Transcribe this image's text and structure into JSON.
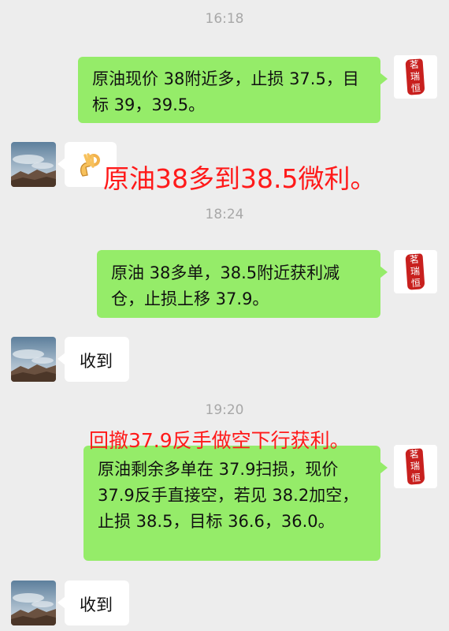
{
  "chat": {
    "times": [
      "16:18",
      "18:24",
      "19:20"
    ],
    "messages": [
      {
        "sender": "self",
        "text": "原油现价 38附近多，止损 37.5，目标 39，39.5。"
      },
      {
        "sender": "other",
        "emoji": "ok-hand-emoji"
      },
      {
        "sender": "self",
        "text": "原油 38多单，38.5附近获利减仓，止损上移 37.9。"
      },
      {
        "sender": "other",
        "text": "收到"
      },
      {
        "sender": "self",
        "text": "原油剩余多单在 37.9扫损，现价 37.9反手直接空，若见 38.2加空，止损 38.5，目标 36.6，36.0。"
      },
      {
        "sender": "other",
        "text": "收到"
      }
    ]
  },
  "annotations": {
    "first": "原油38多到38.5微利。",
    "second": "回撤37.9反手做空下行获利。"
  },
  "self_avatar": {
    "seal_chars": [
      "茗",
      "瑞",
      "恒"
    ],
    "seal_color": "#c8201e"
  },
  "colors": {
    "background": "#ededed",
    "self_bubble": "#95ec69",
    "other_bubble": "#ffffff",
    "annotation": "#ff1a1a",
    "timestamp": "#a8a8a8"
  },
  "icons": {
    "self_avatar": "seal-stamp-avatar",
    "other_avatar": "landscape-avatar",
    "reaction": "ok-hand-emoji"
  }
}
